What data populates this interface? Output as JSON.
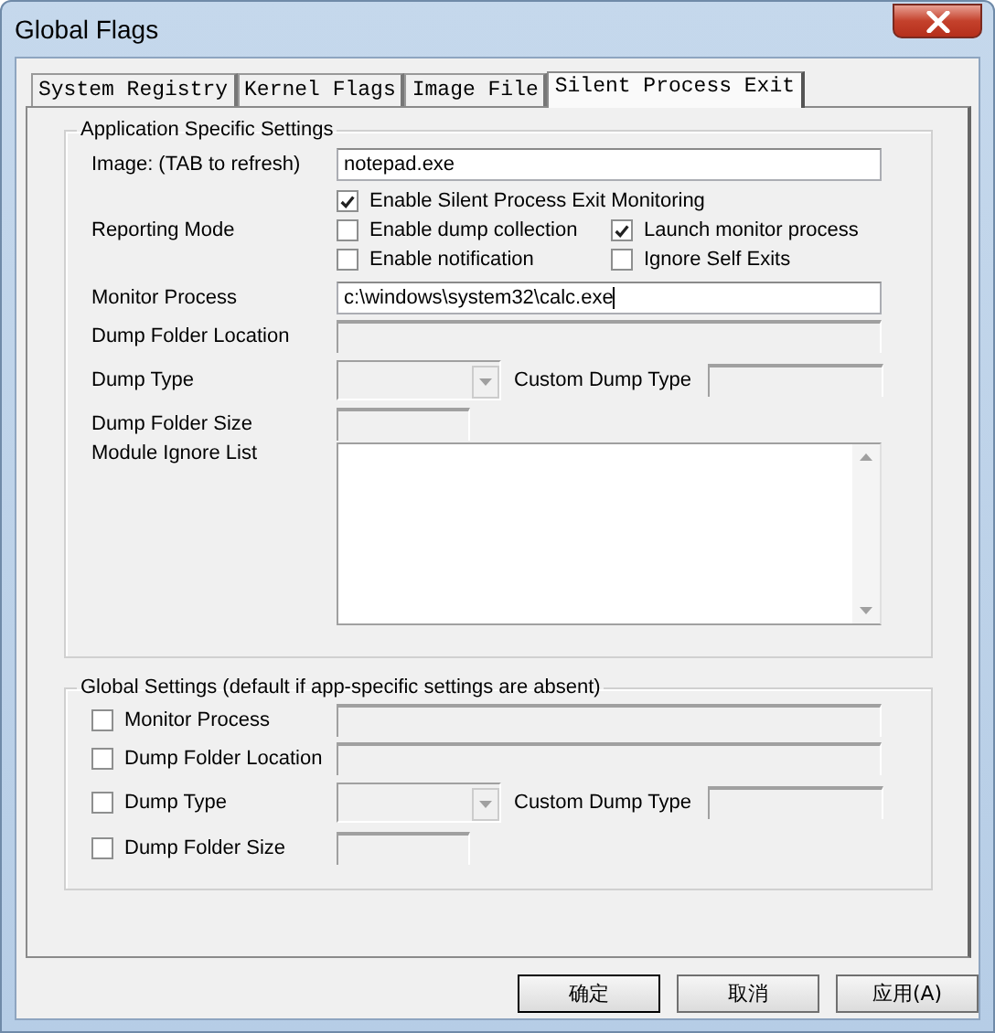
{
  "window": {
    "title": "Global Flags"
  },
  "tabs": [
    {
      "label": "System Registry",
      "selected": false
    },
    {
      "label": "Kernel Flags",
      "selected": false
    },
    {
      "label": "Image File",
      "selected": false
    },
    {
      "label": "Silent Process Exit",
      "selected": true
    }
  ],
  "app_settings": {
    "title": "Application Specific Settings",
    "image": {
      "label": "Image:  (TAB to refresh)",
      "value": "notepad.exe",
      "disabled": false
    },
    "reporting_mode": {
      "label": "Reporting Mode",
      "options": [
        {
          "label": "Enable Silent Process Exit Monitoring",
          "checked": true
        },
        {
          "label": "Enable dump collection",
          "checked": false
        },
        {
          "label": "Launch monitor process",
          "checked": true
        },
        {
          "label": "Enable notification",
          "checked": false
        },
        {
          "label": "Ignore Self Exits",
          "checked": false
        }
      ]
    },
    "monitor_process": {
      "label": "Monitor Process",
      "value": "c:\\windows\\system32\\calc.exe",
      "disabled": false
    },
    "dump_folder_location": {
      "label": "Dump Folder Location",
      "disabled": true
    },
    "dump_type": {
      "label": "Dump Type",
      "disabled": true
    },
    "custom_dump_type": {
      "label": "Custom Dump Type",
      "disabled": true
    },
    "dump_folder_size": {
      "label": "Dump Folder Size",
      "disabled": true
    },
    "module_ignore_list": {
      "label": "Module Ignore List",
      "disabled": false
    }
  },
  "global_settings": {
    "title": "Global Settings (default if app-specific settings are absent)",
    "items": [
      {
        "label": "Monitor Process",
        "checked": false,
        "kind": "text"
      },
      {
        "label": "Dump Folder Location",
        "checked": false,
        "kind": "text"
      },
      {
        "label": "Dump Type",
        "checked": false,
        "kind": "combo"
      },
      {
        "label": "Dump Folder Size",
        "checked": false,
        "kind": "short"
      }
    ],
    "custom_dump_type": {
      "label": "Custom Dump Type"
    }
  },
  "buttons": [
    "确定",
    "取消",
    "应用(A)"
  ]
}
